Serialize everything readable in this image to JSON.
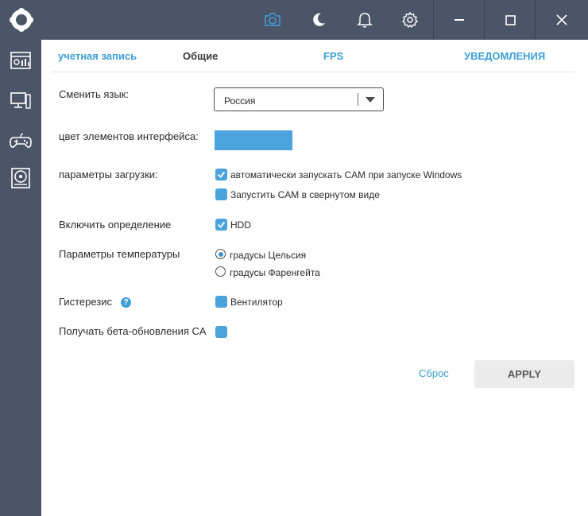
{
  "sidebar": {
    "items": [
      {
        "icon": "dashboard-icon"
      },
      {
        "icon": "monitor-icon"
      },
      {
        "icon": "gamepad-icon"
      },
      {
        "icon": "storage-icon"
      }
    ]
  },
  "topbar": {
    "icons": [
      "camera-icon",
      "moon-icon",
      "bell-icon",
      "gear-icon"
    ],
    "window_controls": [
      "minimize-icon",
      "maximize-icon",
      "close-icon"
    ]
  },
  "tabs": [
    {
      "label": "учетная запись",
      "active": false
    },
    {
      "label": "Общие",
      "active": true
    },
    {
      "label": "FPS",
      "active": false
    },
    {
      "label": "УВЕДОМЛЕНИЯ",
      "active": false
    }
  ],
  "settings": {
    "language": {
      "label": "Сменить язык:",
      "value": "Россия"
    },
    "ui_color": {
      "label": "цвет элементов интерфейса:",
      "color": "#4aa3dd"
    },
    "startup": {
      "label": "параметры загрузки:",
      "options": [
        {
          "label": "автоматически запускать CAM при запуске Windows",
          "checked": true
        },
        {
          "label": "Запустить CAM в свернутом виде",
          "checked": false
        }
      ]
    },
    "detection": {
      "label": "Включить определение",
      "option": {
        "label": "HDD",
        "checked": true
      }
    },
    "temperature": {
      "label": "Параметры температуры",
      "options": [
        {
          "label": "градусы Цельсия",
          "selected": true
        },
        {
          "label": "градусы Фаренгейта",
          "selected": false
        }
      ]
    },
    "hysteresis": {
      "label": "Гистерезис",
      "help": "?",
      "option": {
        "label": "Вентилятор",
        "checked": false
      }
    },
    "beta": {
      "label": "Получать бета-обновления CA",
      "checked": false
    }
  },
  "actions": {
    "reset_label": "Сброс",
    "apply_label": "APPLY"
  },
  "colors": {
    "accent": "#3d9ed8",
    "sidebar": "#4b5567"
  }
}
